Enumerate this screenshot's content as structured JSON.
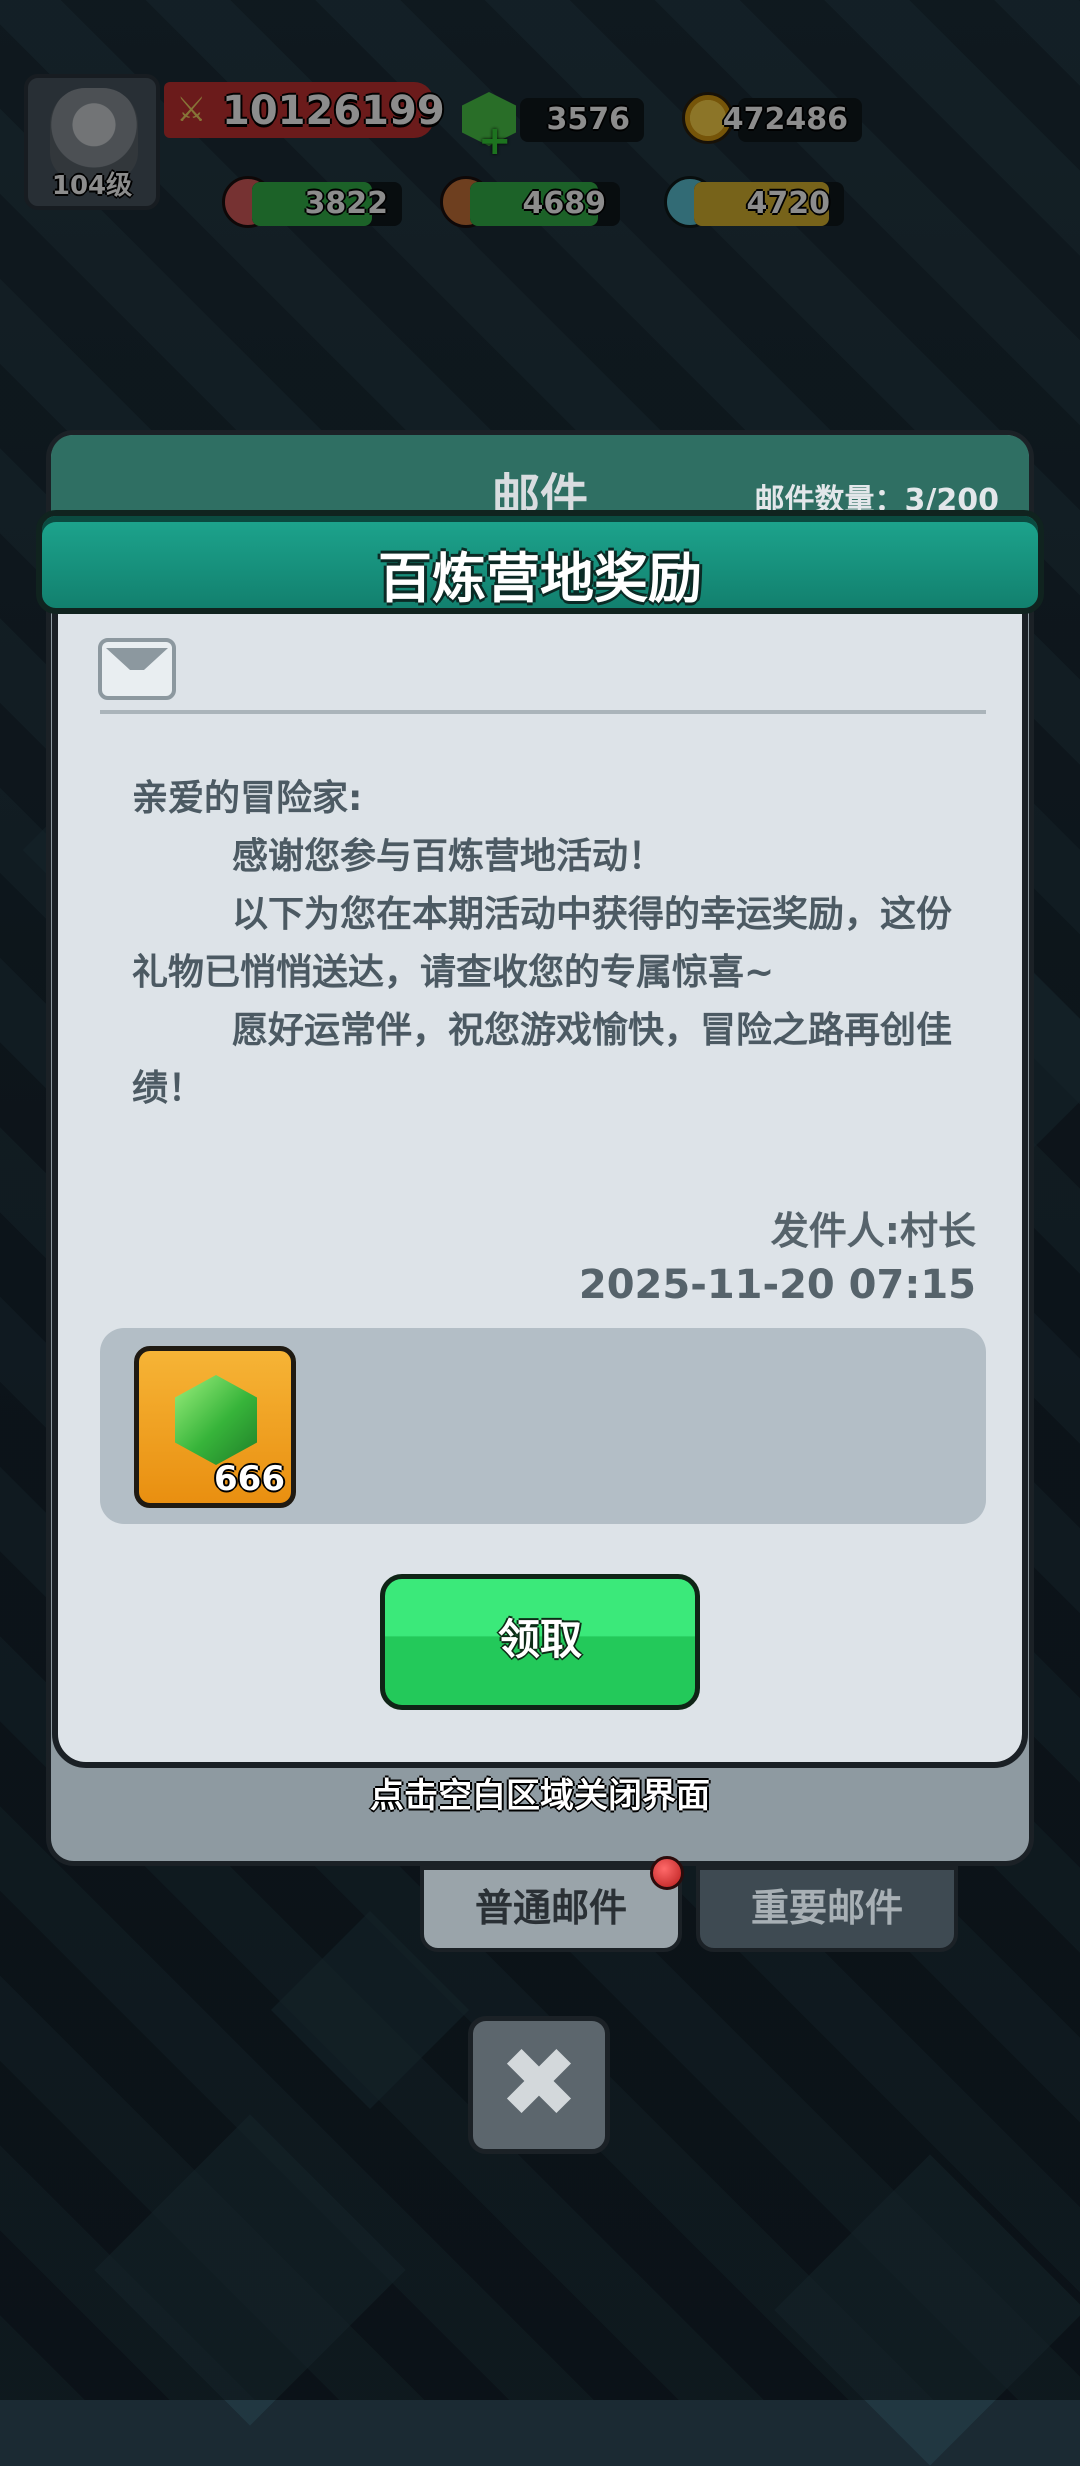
{
  "hud": {
    "avatar_level": "104级",
    "power": "10126199",
    "gems": "3576",
    "gold": "472486",
    "meat": "3822",
    "wood": "4689",
    "crystal": "4720",
    "icons": [
      "sword-icon",
      "gem-icon",
      "coin-icon",
      "meat-icon",
      "wood-icon",
      "crystal-icon"
    ]
  },
  "mail_panel": {
    "title": "邮件",
    "count": "邮件数量：3/200",
    "close_hint": "点击空白区域关闭界面",
    "tabs": [
      {
        "label": "普通邮件",
        "active": true,
        "has_notification": true
      },
      {
        "label": "重要邮件",
        "active": false
      }
    ],
    "close_button": "✖"
  },
  "popup": {
    "title": "百炼营地奖励",
    "letter": {
      "greeting": "亲爱的冒险家:",
      "line1": "感谢您参与百炼营地活动！",
      "line2": "以下为您在本期活动中获得的幸运奖励，这份礼物已悄悄送达，请查收您的专属惊喜~",
      "line3": "愿好运常伴，祝您游戏愉快，冒险之路再创佳绩！"
    },
    "sender": "发件人:村长",
    "date": "2025-11-20 07:15",
    "reward": {
      "icon": "gem-icon",
      "count": "666"
    },
    "claim_label": "领取"
  },
  "colors": {
    "banner": "#1da58e",
    "claim_button": "#2ad564",
    "reward_bg": "#f1a12a"
  }
}
